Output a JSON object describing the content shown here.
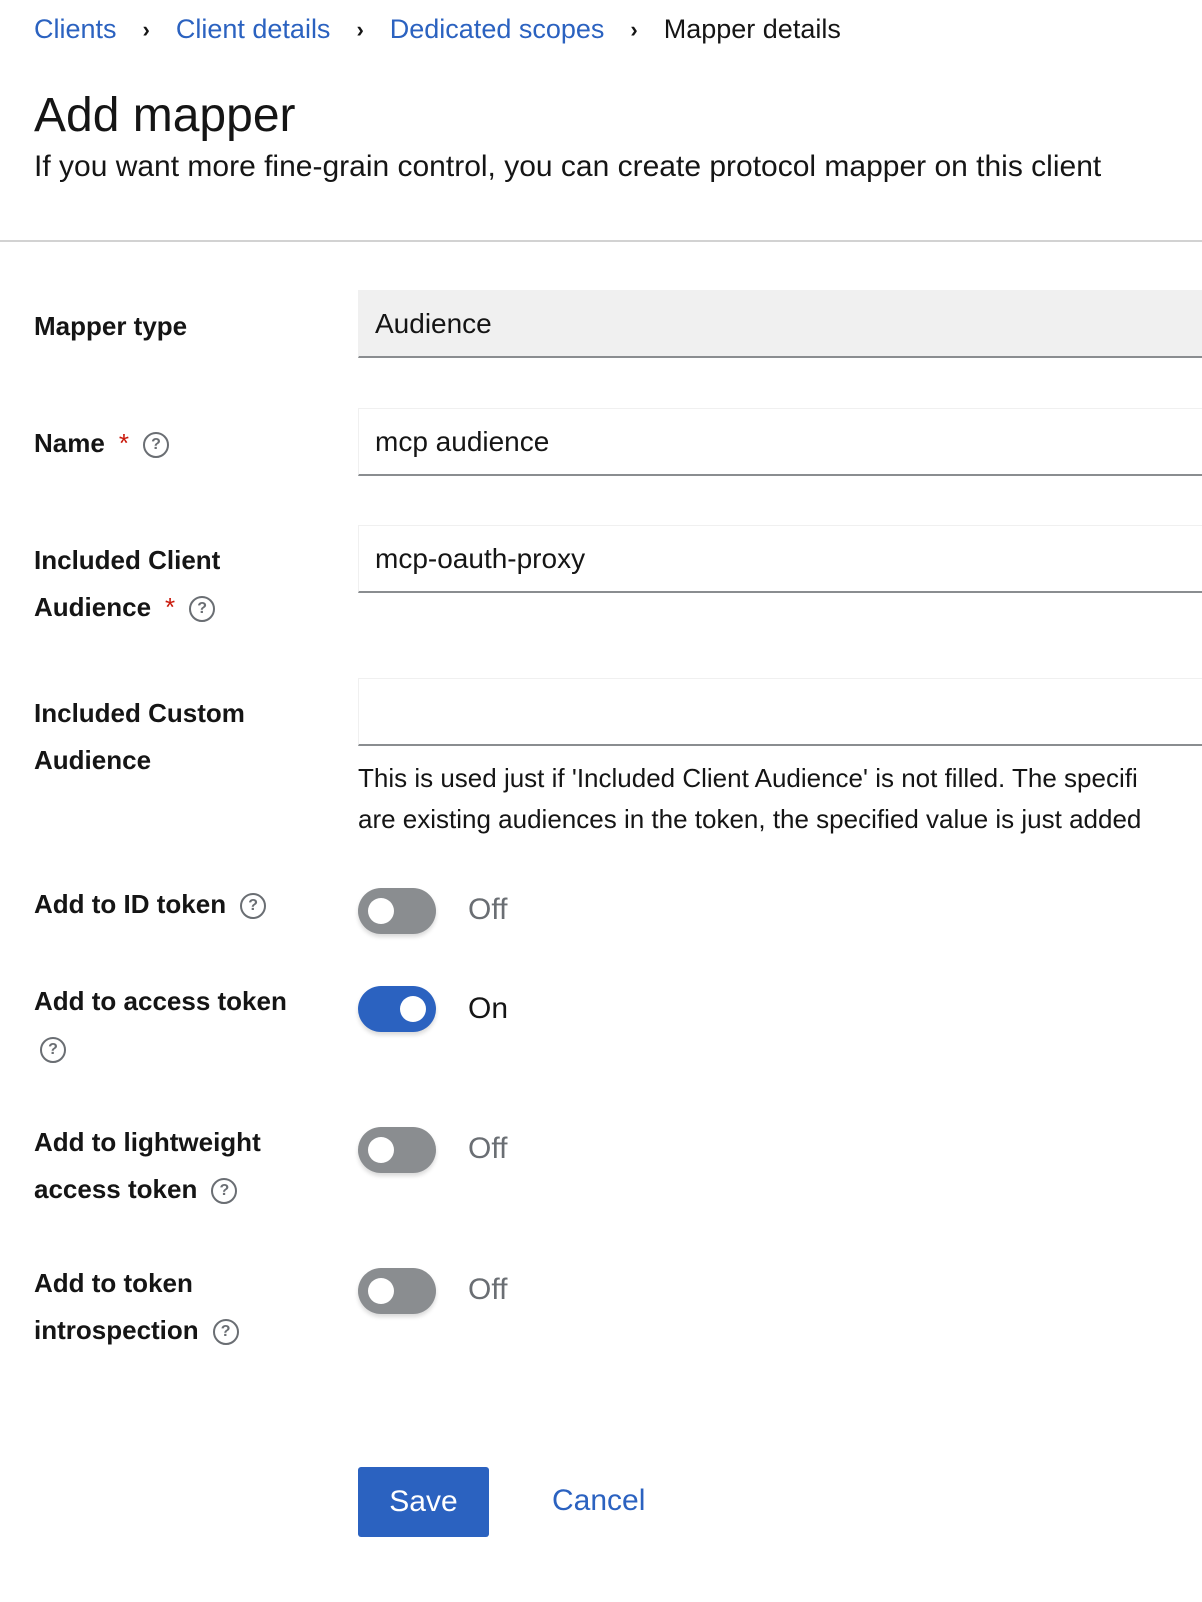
{
  "breadcrumb": [
    "Clients",
    "Client details",
    "Dedicated scopes",
    "Mapper details"
  ],
  "title": "Add mapper",
  "subtitle": "If you want more fine-grain control, you can create protocol mapper on this client",
  "fields": {
    "mapper_type": {
      "label": "Mapper type",
      "value": "Audience"
    },
    "name": {
      "label": "Name",
      "value": "mcp audience",
      "required": "*"
    },
    "included_client_audience": {
      "label_1": "Included Client",
      "label_2": "Audience",
      "value": "mcp-oauth-proxy",
      "required": "*"
    },
    "included_custom_audience": {
      "label_1": "Included Custom",
      "label_2": "Audience",
      "value": "",
      "helper_1": "This is used just if 'Included Client Audience' is not filled. The specifi",
      "helper_2": "are existing audiences in the token, the specified value is just added"
    }
  },
  "toggles": [
    {
      "label": "Add to ID token",
      "state": "Off"
    },
    {
      "label": "Add to access token",
      "state": "On"
    },
    {
      "label_1": "Add to lightweight",
      "label_2": "access token",
      "state": "Off"
    },
    {
      "label_1": "Add to token",
      "label_2": "introspection",
      "state": "Off"
    }
  ],
  "help_glyph": "?",
  "actions": {
    "save": "Save",
    "cancel": "Cancel"
  },
  "colors": {
    "primary": "#2b62c0",
    "required": "#c9190b"
  }
}
